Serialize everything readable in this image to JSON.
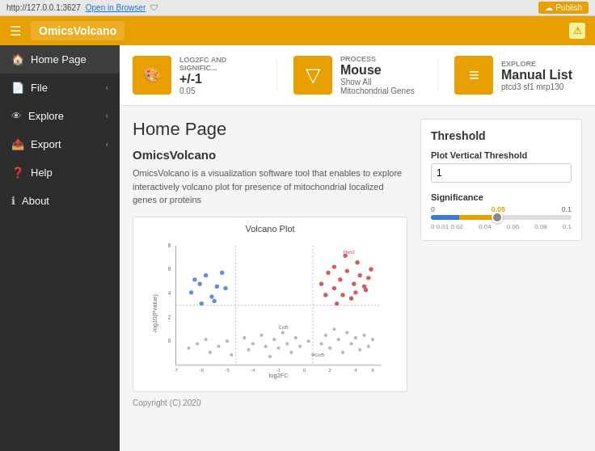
{
  "browser": {
    "url": "http://127.0.0.1:3627",
    "open_in_browser": "Open in Browser",
    "publish_label": "Publish"
  },
  "header": {
    "logo": "OmicsVolcano",
    "hamburger_icon": "☰",
    "warning_icon": "⚠"
  },
  "sidebar": {
    "items": [
      {
        "id": "home",
        "icon": "🏠",
        "label": "Home Page",
        "chevron": false
      },
      {
        "id": "file",
        "icon": "📄",
        "label": "File",
        "chevron": true
      },
      {
        "id": "explore",
        "icon": "👁",
        "label": "Explore",
        "chevron": true
      },
      {
        "id": "export",
        "icon": "📤",
        "label": "Export",
        "chevron": true
      },
      {
        "id": "help",
        "icon": "❓",
        "label": "Help",
        "chevron": false
      },
      {
        "id": "about",
        "icon": "ℹ",
        "label": "About",
        "chevron": false
      }
    ]
  },
  "info_cards": [
    {
      "id": "log2fc",
      "icon": "🎨",
      "label": "LOG2FC AND SIGNIFIC...",
      "value": "+/-1",
      "sub": "0.05"
    },
    {
      "id": "process",
      "icon": "▽",
      "label": "PROCESS",
      "value": "Mouse",
      "sub": "Show All Mitochondrial Genes"
    },
    {
      "id": "explore",
      "icon": "≡",
      "label": "EXPLORE",
      "value": "Manual List",
      "sub": "ptcd3 sf1 mrp130"
    }
  ],
  "page": {
    "title": "Home Page",
    "section_title": "OmicsVolcano",
    "section_text": "OmicsVolcano is a visualization software tool that enables to explore interactively volcano plot for presence of mitochondrial localized genes or proteins",
    "plot_title": "Volcano Plot",
    "copyright": "Copyright (C) 2020"
  },
  "threshold": {
    "title": "Threshold",
    "plot_vertical_label": "Plot Vertical Threshold",
    "plot_vertical_value": "1",
    "significance_label": "Significance",
    "slider_min": "0",
    "slider_highlight": "0.05",
    "slider_max": "0.1",
    "slider_ticks": [
      "0  0.01 0.02",
      "0.04",
      "0.06",
      "0.08",
      "0.1"
    ]
  }
}
